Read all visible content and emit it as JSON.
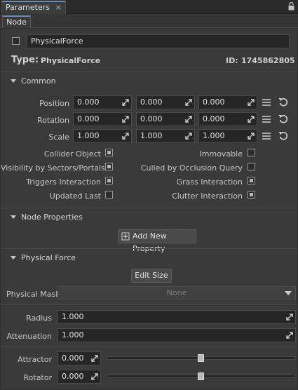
{
  "window": {
    "tab_title": "Parameters",
    "close": "×"
  },
  "subtab": "Node",
  "node": {
    "name": "PhysicalForce",
    "enabled": false,
    "type_label": "Type:",
    "type_value": "PhysicalForce",
    "id_label": "ID:",
    "id_value": "1745862805"
  },
  "common": {
    "title": "Common",
    "rows": [
      {
        "label": "Position",
        "values": [
          "0.000",
          "0.000",
          "0.000"
        ]
      },
      {
        "label": "Rotation",
        "values": [
          "0.000",
          "0.000",
          "0.000"
        ]
      },
      {
        "label": "Scale",
        "values": [
          "1.000",
          "1.000",
          "1.000"
        ]
      }
    ],
    "flags_left": [
      {
        "label": "Collider Object",
        "checked": true
      },
      {
        "label": "Visibility by Sectors/Portals",
        "checked": true
      },
      {
        "label": "Triggers Interaction",
        "checked": true
      },
      {
        "label": "Updated Last",
        "checked": false
      }
    ],
    "flags_right": [
      {
        "label": "Immovable",
        "checked": false
      },
      {
        "label": "Culled by Occlusion Query",
        "checked": false
      },
      {
        "label": "Grass Interaction",
        "checked": true
      },
      {
        "label": "Clutter Interaction",
        "checked": true
      }
    ]
  },
  "node_properties": {
    "title": "Node Properties",
    "add_button": "Add New Property"
  },
  "physical_force": {
    "title": "Physical Force",
    "edit_size_button": "Edit Size",
    "mask_label": "Physical Mask",
    "mask_value": "None",
    "radius_label": "Radius",
    "radius_value": "1.000",
    "attenuation_label": "Attenuation",
    "attenuation_value": "1.000",
    "attractor_label": "Attractor",
    "attractor_value": "0.000",
    "attractor_slider_fraction": 0.5,
    "rotator_label": "Rotator",
    "rotator_value": "0.000",
    "rotator_slider_fraction": 0.5
  },
  "icons": {
    "lock": "lock-icon",
    "drag": "drag-arrows-icon",
    "list": "list-icon",
    "reset": "reset-icon",
    "add": "add-property-icon"
  },
  "colors": {
    "accent": "#6a8fb6",
    "background": "#3a3a3a",
    "field": "#262626"
  }
}
